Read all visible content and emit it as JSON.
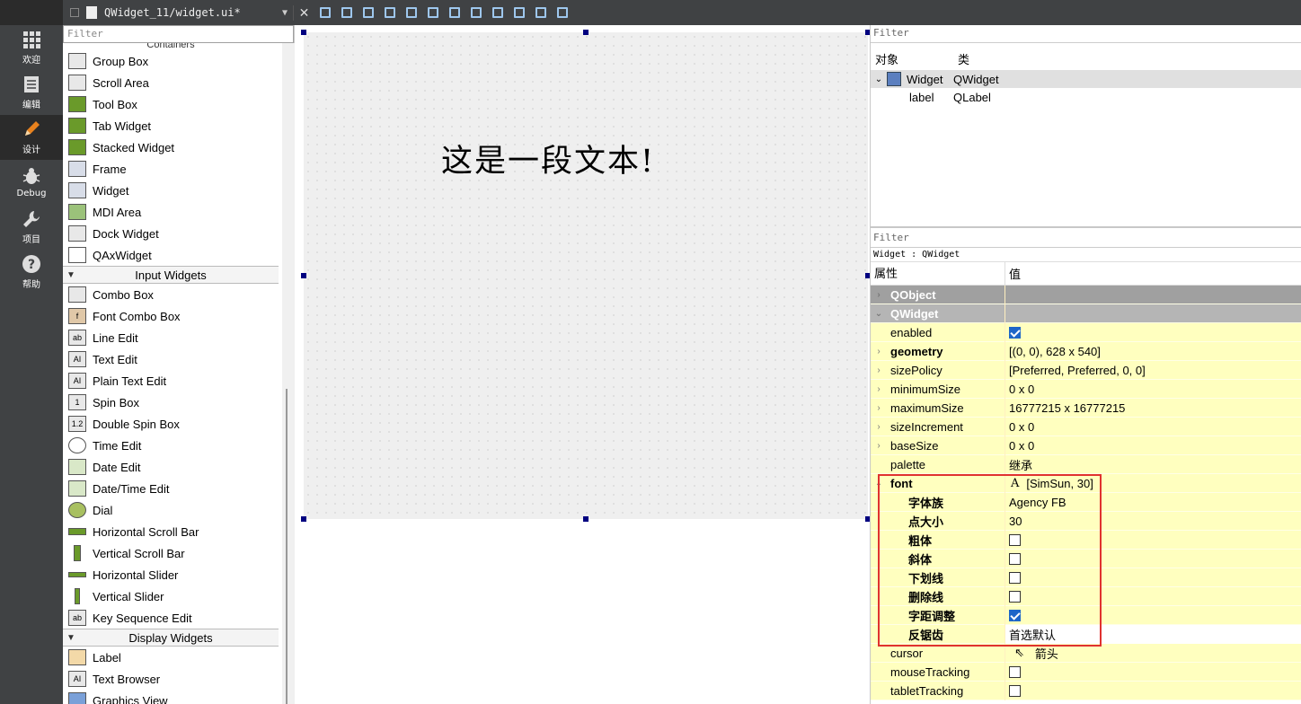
{
  "modes": [
    {
      "label": "欢迎",
      "icon": "grid-icon"
    },
    {
      "label": "编辑",
      "icon": "document-icon"
    },
    {
      "label": "设计",
      "icon": "pencil-icon",
      "active": true
    },
    {
      "label": "Debug",
      "icon": "bug-icon"
    },
    {
      "label": "项目",
      "icon": "wrench-icon"
    },
    {
      "label": "帮助",
      "icon": "help-icon"
    }
  ],
  "toolbar": {
    "file_name": "QWidget_11/widget.ui*",
    "close": "✕"
  },
  "widgetbox": {
    "filter_placeholder": "Filter",
    "cut_heading": "Containers",
    "containers": [
      "Group Box",
      "Scroll Area",
      "Tool Box",
      "Tab Widget",
      "Stacked Widget",
      "Frame",
      "Widget",
      "MDI Area",
      "Dock Widget",
      "QAxWidget"
    ],
    "input_heading": "Input Widgets",
    "inputs": [
      "Combo Box",
      "Font Combo Box",
      "Line Edit",
      "Text Edit",
      "Plain Text Edit",
      "Spin Box",
      "Double Spin Box",
      "Time Edit",
      "Date Edit",
      "Date/Time Edit",
      "Dial",
      "Horizontal Scroll Bar",
      "Vertical Scroll Bar",
      "Horizontal Slider",
      "Vertical Slider",
      "Key Sequence Edit"
    ],
    "display_heading": "Display Widgets",
    "displays": [
      "Label",
      "Text Browser",
      "Graphics View"
    ]
  },
  "form": {
    "label_text": "这是一段文本!"
  },
  "object_inspector": {
    "filter_placeholder": "Filter",
    "col_object": "对象",
    "col_class": "类",
    "rows": [
      {
        "object": "Widget",
        "class": "QWidget"
      },
      {
        "object": "label",
        "class": "QLabel"
      }
    ]
  },
  "property_editor": {
    "filter_placeholder": "Filter",
    "class_line": "Widget : QWidget",
    "col_property": "属性",
    "col_value": "值",
    "groups": [
      "QObject",
      "QWidget"
    ],
    "rows": [
      {
        "name": "enabled",
        "value": ""
      },
      {
        "name": "geometry",
        "value": "[(0, 0), 628 x 540]"
      },
      {
        "name": "sizePolicy",
        "value": "[Preferred, Preferred, 0, 0]"
      },
      {
        "name": "minimumSize",
        "value": "0 x 0"
      },
      {
        "name": "maximumSize",
        "value": "16777215 x 16777215"
      },
      {
        "name": "sizeIncrement",
        "value": "0 x 0"
      },
      {
        "name": "baseSize",
        "value": "0 x 0"
      },
      {
        "name": "palette",
        "value": "继承"
      },
      {
        "name": "font",
        "value": "[SimSun, 30]"
      },
      {
        "name": "字体族",
        "value": "Agency FB"
      },
      {
        "name": "点大小",
        "value": "30"
      },
      {
        "name": "粗体",
        "value": ""
      },
      {
        "name": "斜体",
        "value": ""
      },
      {
        "name": "下划线",
        "value": ""
      },
      {
        "name": "删除线",
        "value": ""
      },
      {
        "name": "字距调整",
        "value": ""
      },
      {
        "name": "反锯齿",
        "value": "首选默认"
      },
      {
        "name": "cursor",
        "value": "箭头"
      },
      {
        "name": "mouseTracking",
        "value": ""
      },
      {
        "name": "tabletTracking",
        "value": ""
      }
    ]
  },
  "colors": {
    "accent_checkbox": "#1e66c8",
    "property_row": "#ffffbf",
    "highlight_box": "#e0322f"
  }
}
